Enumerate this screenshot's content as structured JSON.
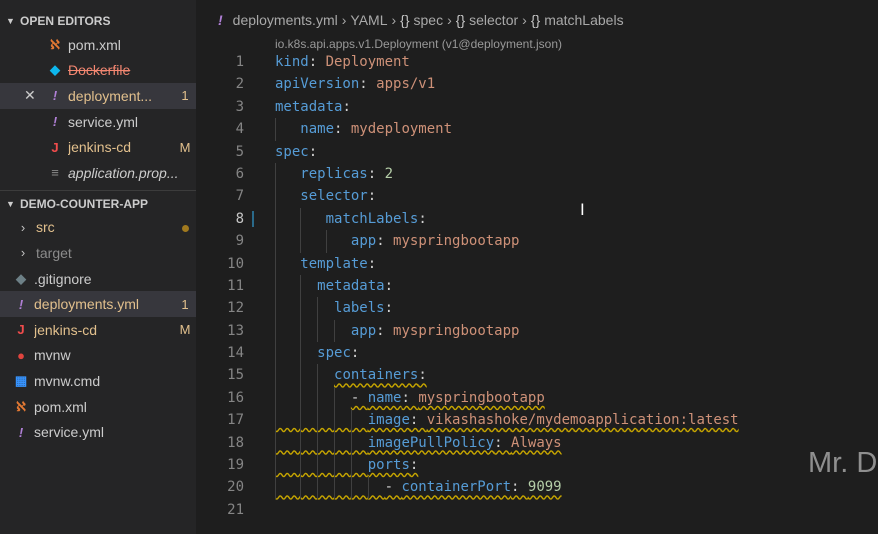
{
  "open_editors": {
    "title": "OPEN EDITORS",
    "items": [
      {
        "label": "pom.xml",
        "icon": "rss-icon",
        "badge": ""
      },
      {
        "label": "Dockerfile",
        "icon": "docker-icon",
        "badge": ""
      },
      {
        "label": "deployment...",
        "icon": "exclamation-icon",
        "badge": "1"
      },
      {
        "label": "service.yml",
        "icon": "exclamation-icon",
        "badge": ""
      },
      {
        "label": "jenkins-cd",
        "icon": "jenkins-icon",
        "badge": "M"
      },
      {
        "label": "application.prop...",
        "icon": "file-icon",
        "badge": ""
      }
    ]
  },
  "explorer": {
    "title": "DEMO-COUNTER-APP",
    "items": [
      {
        "label": "src",
        "badge": ""
      },
      {
        "label": "target",
        "badge": ""
      },
      {
        "label": ".gitignore",
        "badge": ""
      },
      {
        "label": "deployments.yml",
        "badge": "1"
      },
      {
        "label": "jenkins-cd",
        "badge": "M"
      },
      {
        "label": "mvnw",
        "badge": ""
      },
      {
        "label": "mvnw.cmd",
        "badge": ""
      },
      {
        "label": "pom.xml",
        "badge": ""
      },
      {
        "label": "service.yml",
        "badge": ""
      }
    ]
  },
  "breadcrumb": {
    "file": "deployments.yml",
    "items": [
      "YAML",
      "spec",
      "selector",
      "matchLabels"
    ]
  },
  "schema_hint": "io.k8s.api.apps.v1.Deployment (v1@deployment.json)",
  "code": {
    "line_numbers": [
      "1",
      "2",
      "3",
      "4",
      "5",
      "6",
      "7",
      "8",
      "9",
      "10",
      "11",
      "12",
      "13",
      "14",
      "15",
      "16",
      "17",
      "18",
      "19",
      "20",
      "21"
    ],
    "l1": {
      "key": "kind",
      "value": "Deployment"
    },
    "l2": {
      "key": "apiVersion",
      "value": "apps/v1"
    },
    "l3": {
      "key": "metadata"
    },
    "l4": {
      "key": "name",
      "value": "mydeployment"
    },
    "l5": {
      "key": "spec"
    },
    "l6": {
      "key": "replicas",
      "value": "2"
    },
    "l7": {
      "key": "selector"
    },
    "l8": {
      "key": "matchLabels"
    },
    "l9": {
      "key": "app",
      "value": "myspringbootapp"
    },
    "l10": {
      "key": "template"
    },
    "l11": {
      "key": "metadata"
    },
    "l12": {
      "key": "labels"
    },
    "l13": {
      "key": "app",
      "value": "myspringbootapp"
    },
    "l14": {
      "key": "spec"
    },
    "l15": {
      "key": "containers"
    },
    "l16": {
      "key": "name",
      "value": "myspringbootapp"
    },
    "l17": {
      "key": "image",
      "value": "vikashashoke/mydemoapplication:latest"
    },
    "l18": {
      "key": "imagePullPolicy",
      "value": "Always"
    },
    "l19": {
      "key": "ports"
    },
    "l20": {
      "key": "containerPort",
      "value": "9099"
    }
  },
  "watermark": "Mr. D",
  "colors": {
    "key": "#569cd6",
    "string": "#ce9178",
    "number": "#b5cea8",
    "squiggle": "#c7a600"
  }
}
